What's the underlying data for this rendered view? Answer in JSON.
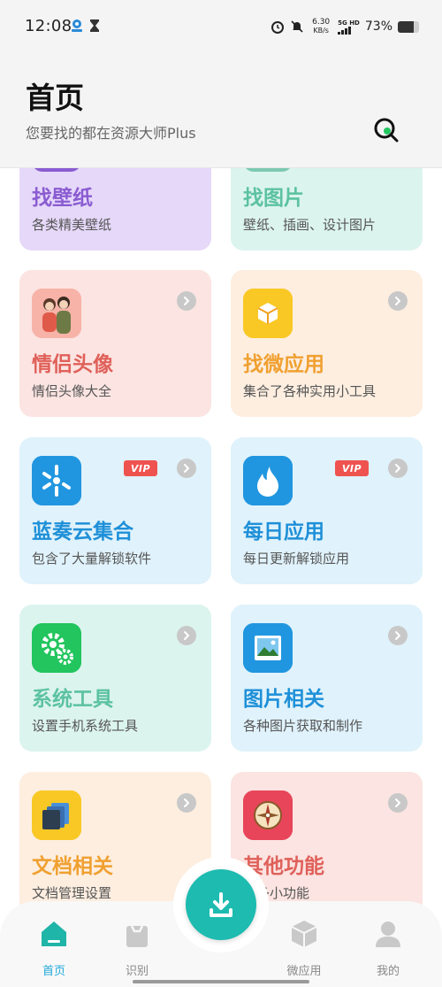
{
  "status_bar": {
    "time": "12:08",
    "net_speed_value": "6.30",
    "net_speed_unit": "KB/s",
    "signal_label": "5G HD",
    "battery_text": "73%",
    "battery_level": 0.73
  },
  "header": {
    "title": "首页",
    "subtitle": "您要找的都在资源大师Plus"
  },
  "cards": [
    {
      "title": "找壁纸",
      "desc": "各类精美壁纸",
      "bg": "#e6d8f9",
      "title_color": "#8a5cd1",
      "vip": false,
      "icon": "wallpaper-icon"
    },
    {
      "title": "找图片",
      "desc": "壁纸、插画、设计图片",
      "bg": "#dcf4ee",
      "title_color": "#5cc2a0",
      "vip": false,
      "icon": "image-icon"
    },
    {
      "title": "情侣头像",
      "desc": "情侣头像大全",
      "bg": "#fbe4e1",
      "title_color": "#e0605a",
      "vip": false,
      "icon": "couple-avatar-icon"
    },
    {
      "title": "找微应用",
      "desc": "集合了各种实用小工具",
      "bg": "#fdeee0",
      "title_color": "#f0a030",
      "vip": false,
      "icon": "box-icon"
    },
    {
      "title": "蓝奏云集合",
      "desc": "包含了大量解锁软件",
      "bg": "#e0f2fb",
      "title_color": "#1e90d8",
      "vip": true,
      "vip_label": "VIP",
      "icon": "lanzou-cloud-icon"
    },
    {
      "title": "每日应用",
      "desc": "每日更新解锁应用",
      "bg": "#e0f2fb",
      "title_color": "#1e90d8",
      "vip": true,
      "vip_label": "VIP",
      "icon": "flame-icon"
    },
    {
      "title": "系统工具",
      "desc": "设置手机系统工具",
      "bg": "#dcf4ee",
      "title_color": "#5cc2a0",
      "vip": false,
      "icon": "gear-icon"
    },
    {
      "title": "图片相关",
      "desc": "各种图片获取和制作",
      "bg": "#e0f2fb",
      "title_color": "#1e90d8",
      "vip": false,
      "icon": "picture-icon"
    },
    {
      "title": "文档相关",
      "desc": "文档管理设置",
      "bg": "#fdeee0",
      "title_color": "#f0a030",
      "vip": false,
      "icon": "document-icon"
    },
    {
      "title": "其他功能",
      "desc": "更多小功能",
      "bg": "#fbe4e1",
      "title_color": "#e0605a",
      "vip": false,
      "icon": "compass-icon"
    }
  ],
  "bottom_nav": {
    "items": [
      {
        "label": "首页",
        "icon": "home-icon",
        "active": true
      },
      {
        "label": "识别",
        "icon": "bag-icon",
        "active": false
      },
      {
        "label": "微应用",
        "icon": "cube-icon",
        "active": false
      },
      {
        "label": "我的",
        "icon": "user-icon",
        "active": false
      }
    ],
    "fab_icon": "download-icon"
  },
  "colors": {
    "accent": "#1fa8d8",
    "fab": "#1dbbb0"
  }
}
